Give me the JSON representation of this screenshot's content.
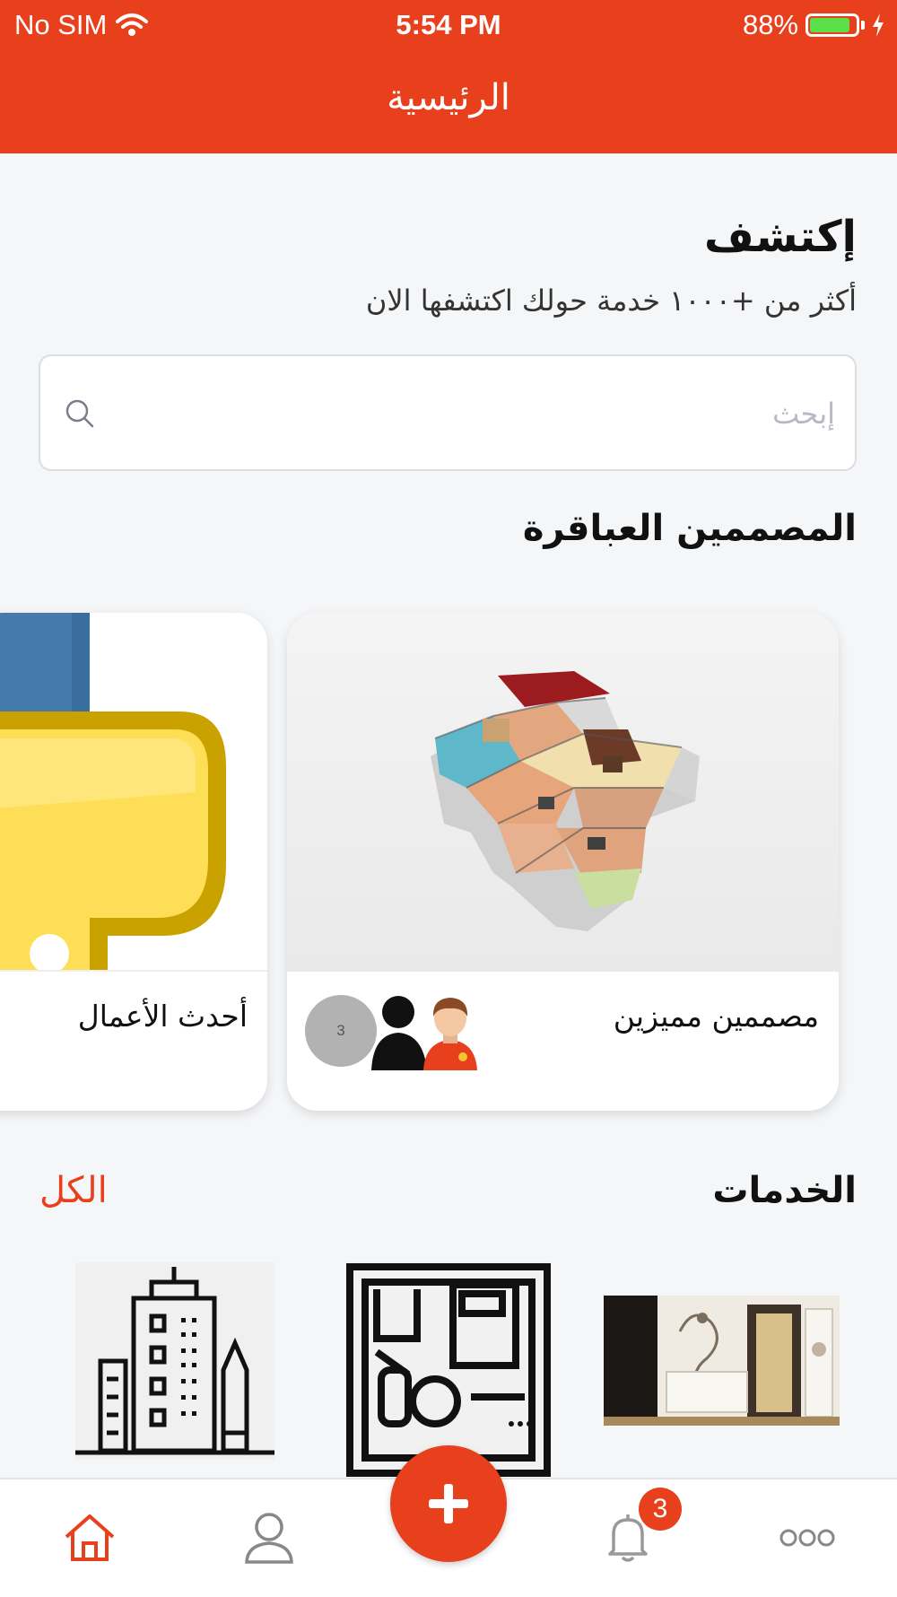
{
  "status_bar": {
    "carrier": "No SIM",
    "time": "5:54 PM",
    "battery": "88%",
    "battery_level": 0.88
  },
  "header": {
    "title": "الرئيسية"
  },
  "discover": {
    "title": "إكتشف",
    "subtitle": "أكثر من +١٠٠٠ خدمة حولك اكتشفها الان"
  },
  "search": {
    "placeholder": "إبحث",
    "value": ""
  },
  "designers": {
    "title": "المصممين العباقرة",
    "cards": [
      {
        "label": "مصممين مميزين",
        "count": "3"
      },
      {
        "label": "أحدث الأعمال"
      }
    ]
  },
  "services": {
    "title": "الخدمات",
    "all_label": "الكل"
  },
  "tabbar": {
    "notification_count": "3"
  },
  "colors": {
    "accent": "#e8401c",
    "background": "#f5f6f8"
  },
  "icons": [
    "wifi-icon",
    "battery-icon",
    "charging-icon",
    "search-icon",
    "home-icon",
    "user-icon",
    "plus-icon",
    "bell-icon",
    "more-icon"
  ]
}
